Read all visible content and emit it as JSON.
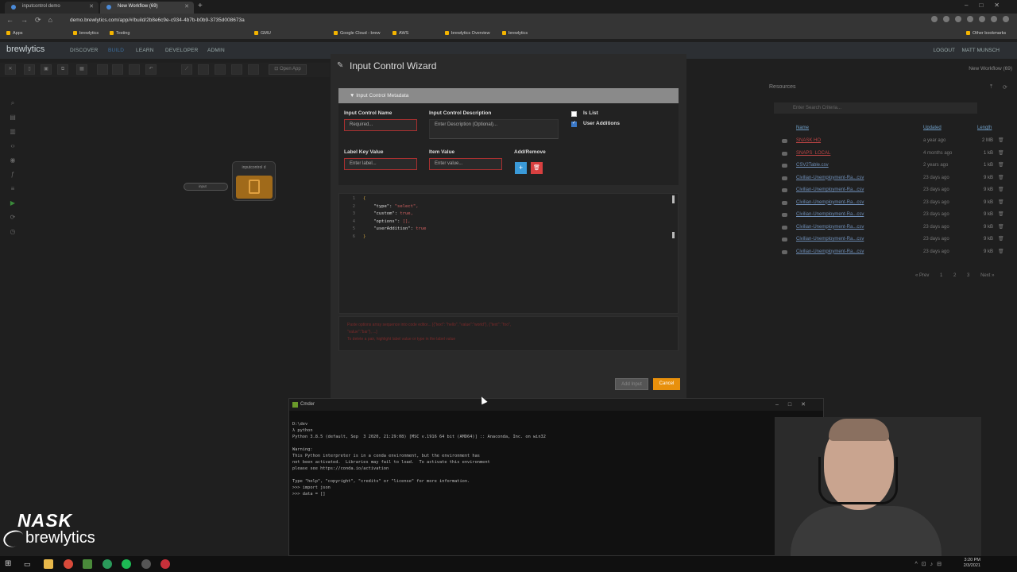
{
  "browser": {
    "tabs": [
      {
        "label": "inputcontrol demo"
      },
      {
        "label": "New Workflow (69)"
      }
    ],
    "url": "demo.brewlytics.com/app/#/build/2b8e6c9e-c934-4b7b-b0b9-3735d008673a",
    "bookmarks": [
      "Apps",
      "brewlytics",
      "Testing",
      "GMU",
      "Google Cloud - brew",
      "AWS",
      "brewlytics Overview",
      "brewlytics",
      "Other bookmarks"
    ]
  },
  "appnav": {
    "logo": "brewlytics",
    "items": [
      "DISCOVER",
      "BUILD",
      "LEARN",
      "DEVELOPER",
      "ADMIN"
    ],
    "logout": "LOGOUT",
    "user": "MATT MUNSCH"
  },
  "toolbar": {
    "open_app": "Open App",
    "workflow_name": "New Workflow (69)"
  },
  "canvas": {
    "node_label": "inputcontrol d",
    "input_port_label": "input"
  },
  "resources": {
    "title": "Resources",
    "search_placeholder": "Enter Search Criteria...",
    "headers": {
      "name": "Name",
      "updated": "Updated",
      "length": "Length"
    },
    "rows": [
      {
        "name": "SNASK HO",
        "updated": "a year ago",
        "length": "2 MB",
        "red": true
      },
      {
        "name": "SNAPS_LOCAL",
        "updated": "4 months ago",
        "length": "1 kB",
        "red": true
      },
      {
        "name": "CSV2Table.csv",
        "updated": "2 years ago",
        "length": "1 kB",
        "red": false
      },
      {
        "name": "Civilian-Unemployment-Ra...csv",
        "updated": "23 days ago",
        "length": "9 kB",
        "red": false
      },
      {
        "name": "Civilian-Unemployment-Ra...csv",
        "updated": "23 days ago",
        "length": "9 kB",
        "red": false
      },
      {
        "name": "Civilian-Unemployment-Ra...csv",
        "updated": "23 days ago",
        "length": "9 kB",
        "red": false
      },
      {
        "name": "Civilian-Unemployment-Ra...csv",
        "updated": "23 days ago",
        "length": "9 kB",
        "red": false
      },
      {
        "name": "Civilian-Unemployment-Ra...csv",
        "updated": "23 days ago",
        "length": "9 kB",
        "red": false
      },
      {
        "name": "Civilian-Unemployment-Ra...csv",
        "updated": "23 days ago",
        "length": "9 kB",
        "red": false
      },
      {
        "name": "Civilian-Unemployment-Ra...csv",
        "updated": "23 days ago",
        "length": "9 kB",
        "red": false
      }
    ],
    "pager": {
      "prev": "« Prev",
      "pages": [
        "1",
        "2",
        "3"
      ],
      "next": "Next »"
    }
  },
  "modal": {
    "title": "Input Control Wizard",
    "section": "Input Control Metadata",
    "name_label": "Input Control Name",
    "name_placeholder": "Required...",
    "desc_label": "Input Control Description",
    "desc_placeholder": "Enter Description (Optional)...",
    "is_list_label": "Is List",
    "is_list_checked": false,
    "user_additions_label": "User Additions",
    "user_additions_checked": true,
    "label_key_label": "Label Key Value",
    "label_key_placeholder": "Enter label...",
    "item_value_label": "Item Value",
    "item_value_placeholder": "Enter value...",
    "add_remove_label": "Add/Remove",
    "code": [
      {
        "n": "1",
        "text": "{"
      },
      {
        "n": "2",
        "key": "\"type\"",
        "val": "\"select\","
      },
      {
        "n": "3",
        "key": "\"custom\"",
        "val": "true,"
      },
      {
        "n": "4",
        "key": "\"options\"",
        "val": "[],"
      },
      {
        "n": "5",
        "key": "\"userAddition\"",
        "val": "true"
      },
      {
        "n": "6",
        "text": "}"
      }
    ],
    "hint_line1": "Paste options array sequence into code editor... [{\"text\": \"hello\", \"value\":\"world\"}, {\"text\": \"foo\",",
    "hint_line2": "\"value\":\"bar\"}, ...]",
    "hint_line3": "To delete a pair, highlight label value or type in the label value",
    "add_input": "Add Input",
    "cancel": "Cancel"
  },
  "terminal": {
    "title": "Cmder",
    "lines": [
      "D:\\dev",
      "λ python",
      "Python 3.8.5 (default, Sep  3 2020, 21:29:08) [MSC v.1916 64 bit (AMD64)] :: Anaconda, Inc. on win32",
      "",
      "Warning:",
      "This Python interpreter is in a conda environment, but the environment has",
      "not been activated.  Libraries may fail to load.  To activate this environment",
      "please see https://conda.io/activation",
      "",
      "Type \"help\", \"copyright\", \"credits\" or \"license\" for more information.",
      ">>> import json",
      ">>> data = []"
    ]
  },
  "watermark": {
    "line1": "NASK",
    "line2": "brewlytics"
  },
  "taskbar": {
    "time": "3:20 PM",
    "date": "2/3/2021"
  }
}
